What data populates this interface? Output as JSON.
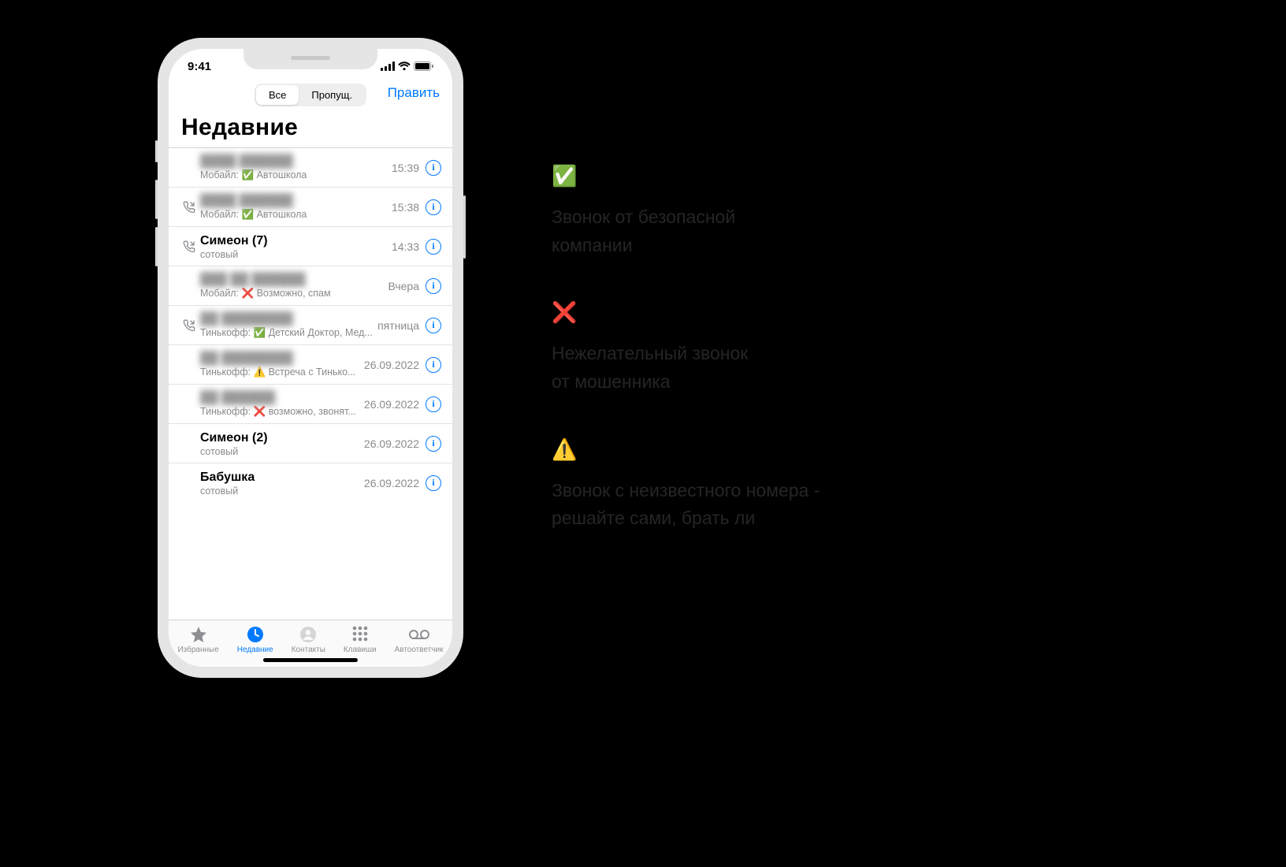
{
  "status": {
    "time": "9:41"
  },
  "topbar": {
    "seg_all": "Все",
    "seg_missed": "Пропущ.",
    "edit": "Править"
  },
  "title": "Недавние",
  "calls": [
    {
      "name": "████ ██████",
      "blur": true,
      "out": false,
      "sub": "Мобайл: ✅ Автошкола",
      "time": "15:39"
    },
    {
      "name": "████ ██████",
      "blur": true,
      "out": true,
      "sub": "Мобайл: ✅ Автошкола",
      "time": "15:38"
    },
    {
      "name": "Симеон (7)",
      "blur": false,
      "out": true,
      "sub": "сотовый",
      "time": "14:33"
    },
    {
      "name": "███ ██ ██████",
      "blur": true,
      "out": false,
      "sub": "Мобайл: ❌ Возможно, спам",
      "time": "Вчера"
    },
    {
      "name": "██ ████████",
      "blur": true,
      "out": true,
      "sub": "Тинькофф: ✅ Детский Доктор, Мед...",
      "time": "пятница"
    },
    {
      "name": "██ ████████",
      "blur": true,
      "out": false,
      "sub": "Тинькофф: ⚠️ Встреча с Тинько...",
      "time": "26.09.2022"
    },
    {
      "name": "██ ██████",
      "blur": true,
      "out": false,
      "sub": "Тинькофф: ❌ возможно, звонят...",
      "time": "26.09.2022"
    },
    {
      "name": "Симеон (2)",
      "blur": false,
      "out": false,
      "sub": "сотовый",
      "time": "26.09.2022"
    },
    {
      "name": "Бабушка",
      "blur": false,
      "out": false,
      "sub": "сотовый",
      "time": "26.09.2022"
    }
  ],
  "tabs": {
    "favorites": "Избранные",
    "recents": "Недавние",
    "contacts": "Контакты",
    "keypad": "Клавиши",
    "voicemail": "Автоответчик"
  },
  "legend": {
    "ok": {
      "icon": "✅",
      "line1": "Звонок от безопасной",
      "line2": "компании"
    },
    "bad": {
      "icon": "❌",
      "line1": "Нежелательный звонок",
      "line2": "от мошенника"
    },
    "warn": {
      "icon": "⚠️",
      "line1": "Звонок с неизвестного номера -",
      "line2": "решайте сами, брать ли"
    }
  }
}
